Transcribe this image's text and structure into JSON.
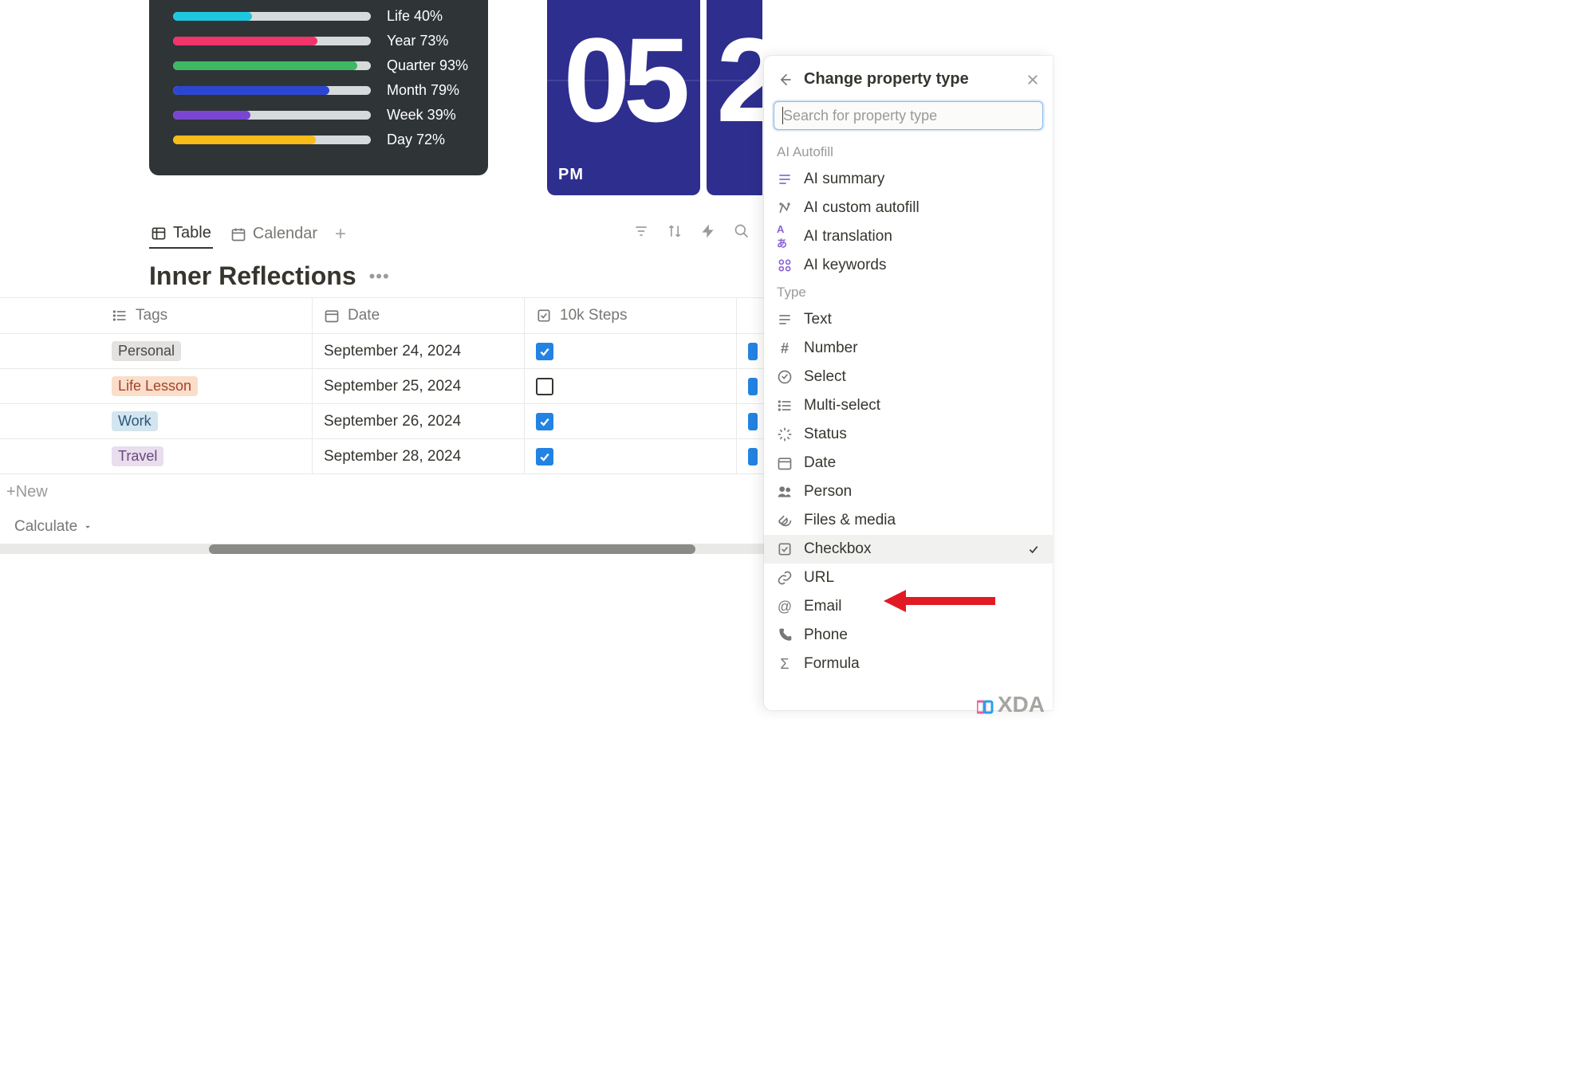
{
  "progress": [
    {
      "label": "Life 40%",
      "percent": 40,
      "color": "#1fc7de"
    },
    {
      "label": "Year 73%",
      "percent": 73,
      "color": "#f1346a"
    },
    {
      "label": "Quarter 93%",
      "percent": 93,
      "color": "#3fb863"
    },
    {
      "label": "Month 79%",
      "percent": 79,
      "color": "#2d46d1"
    },
    {
      "label": "Week 39%",
      "percent": 39,
      "color": "#7a46d1"
    },
    {
      "label": "Day 72%",
      "percent": 72,
      "color": "#f8bb1a"
    }
  ],
  "clock": {
    "number": "05",
    "second_visible": "2",
    "ampm": "PM"
  },
  "tabs": {
    "table": "Table",
    "calendar": "Calendar"
  },
  "title": "Inner Reflections",
  "table": {
    "headers": {
      "tags": "Tags",
      "date": "Date",
      "steps": "10k Steps"
    },
    "rows": [
      {
        "tag": "Personal",
        "tag_bg": "#e3e2e0",
        "tag_color": "#494846",
        "date": "September 24, 2024",
        "checked": true
      },
      {
        "tag": "Life Lesson",
        "tag_bg": "#fadec9",
        "tag_color": "#a3432b",
        "date": "September 25, 2024",
        "checked": false
      },
      {
        "tag": "Work",
        "tag_bg": "#d3e5ef",
        "tag_color": "#2b5779",
        "date": "September 26, 2024",
        "checked": true
      },
      {
        "tag": "Travel",
        "tag_bg": "#e8deee",
        "tag_color": "#6a467c",
        "date": "September 28, 2024",
        "checked": true
      }
    ],
    "new": "New",
    "calculate": "Calculate"
  },
  "panel": {
    "title": "Change property type",
    "search_placeholder": "Search for property type",
    "section_autofill": "AI Autofill",
    "section_type": "Type",
    "items_autofill": [
      {
        "id": "ai-summary",
        "label": "AI summary",
        "icon": "ai-summary"
      },
      {
        "id": "ai-custom-autofill",
        "label": "AI custom autofill",
        "icon": "ai-custom"
      },
      {
        "id": "ai-translation",
        "label": "AI translation",
        "icon": "ai-translate"
      },
      {
        "id": "ai-keywords",
        "label": "AI keywords",
        "icon": "ai-keywords"
      }
    ],
    "items_type": [
      {
        "id": "text",
        "label": "Text",
        "icon": "text"
      },
      {
        "id": "number",
        "label": "Number",
        "icon": "number"
      },
      {
        "id": "select",
        "label": "Select",
        "icon": "select"
      },
      {
        "id": "multi-select",
        "label": "Multi-select",
        "icon": "multi"
      },
      {
        "id": "status",
        "label": "Status",
        "icon": "status"
      },
      {
        "id": "date",
        "label": "Date",
        "icon": "date"
      },
      {
        "id": "person",
        "label": "Person",
        "icon": "person"
      },
      {
        "id": "files-media",
        "label": "Files & media",
        "icon": "files"
      },
      {
        "id": "checkbox",
        "label": "Checkbox",
        "icon": "checkbox",
        "selected": true
      },
      {
        "id": "url",
        "label": "URL",
        "icon": "url"
      },
      {
        "id": "email",
        "label": "Email",
        "icon": "email"
      },
      {
        "id": "phone",
        "label": "Phone",
        "icon": "phone"
      },
      {
        "id": "formula",
        "label": "Formula",
        "icon": "formula"
      }
    ]
  },
  "watermark": "XDA"
}
